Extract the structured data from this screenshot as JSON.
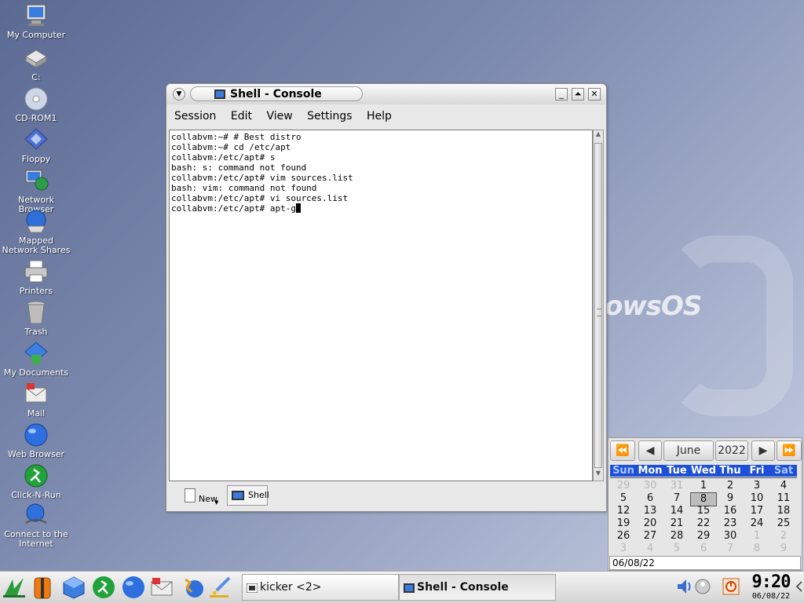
{
  "desktop": {
    "icons": [
      {
        "label": "My Computer"
      },
      {
        "label": "C:"
      },
      {
        "label": "CD-ROM1"
      },
      {
        "label": "Floppy"
      },
      {
        "label": "Network Browser"
      },
      {
        "label": "Mapped Network Shares"
      },
      {
        "label": "Printers"
      },
      {
        "label": "Trash"
      },
      {
        "label": "My Documents"
      },
      {
        "label": "Mail"
      },
      {
        "label": "Web Browser"
      },
      {
        "label": "Click-N-Run"
      },
      {
        "label": "Connect to the Internet"
      }
    ],
    "watermark": "owsOS"
  },
  "window": {
    "title": "Shell - Console",
    "menu": [
      "Session",
      "Edit",
      "View",
      "Settings",
      "Help"
    ],
    "terminal_lines": [
      "collabvm:~# # Best distro",
      "collabvm:~# cd /etc/apt",
      "collabvm:/etc/apt# s",
      "bash: s: command not found",
      "collabvm:/etc/apt# vim sources.list",
      "bash: vim: command not found",
      "collabvm:/etc/apt# vi sources.list",
      "collabvm:/etc/apt# apt-g"
    ],
    "new_label": "New",
    "tab_label": "Shell"
  },
  "calendar": {
    "month": "June",
    "year": "2022",
    "weekdays": [
      "Sun",
      "Mon",
      "Tue",
      "Wed",
      "Thu",
      "Fri",
      "Sat"
    ],
    "weeks": [
      [
        "29",
        "30",
        "31",
        "1",
        "2",
        "3",
        "4"
      ],
      [
        "5",
        "6",
        "7",
        "8",
        "9",
        "10",
        "11"
      ],
      [
        "12",
        "13",
        "14",
        "15",
        "16",
        "17",
        "18"
      ],
      [
        "19",
        "20",
        "21",
        "22",
        "23",
        "24",
        "25"
      ],
      [
        "26",
        "27",
        "28",
        "29",
        "30",
        "1",
        "2"
      ],
      [
        "3",
        "4",
        "5",
        "6",
        "7",
        "8",
        "9"
      ]
    ],
    "selected_day": "8",
    "date_field": "06/08/22"
  },
  "taskbar": {
    "tasks": [
      {
        "label": "kicker <2>"
      },
      {
        "label": "Shell - Console"
      }
    ],
    "clock_time": "9:20",
    "clock_date": "06/08/22"
  },
  "colors": {
    "calendar_header": "#1e4fd8",
    "desktop_bg": "#7e8bb0"
  }
}
